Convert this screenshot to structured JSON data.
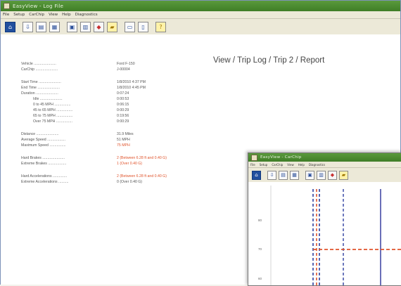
{
  "main": {
    "title": "EasyView - Log File",
    "menu": [
      "File",
      "Setup",
      "CarChip",
      "View",
      "Help",
      "Diagnostics"
    ],
    "toolbar_icons": [
      "home-icon",
      "download-icon",
      "chart-icon",
      "trip-icon",
      "report-icon",
      "log-icon",
      "alarm-icon",
      "folder-icon",
      "print-icon",
      "page-icon",
      "help-icon"
    ],
    "breadcrumb": "View / Trip Log / Trip 2 / Report",
    "report": {
      "vehicle": {
        "label": "Vehicle ......................",
        "value": "Ford F-150"
      },
      "carchip": {
        "label": "CarChip ......................",
        "value": "J-00004"
      },
      "start_time": {
        "label": "Start Time ......................",
        "value": "1/8/2010 4:37 PM"
      },
      "end_time": {
        "label": "End Time ......................",
        "value": "1/8/2010 4:45 PM"
      },
      "duration": {
        "label": "Duration ......................",
        "value": "0:07:24"
      },
      "idle": {
        "label": "Idle ......................",
        "value": "0:00:53"
      },
      "r0_45": {
        "label": "0 to 45 MPH ................",
        "value": "0:06:15"
      },
      "r45_65": {
        "label": "45 to 65 MPH ................",
        "value": "0:00:29"
      },
      "r65_75": {
        "label": "65 to 75 MPH ................",
        "value": "0:19:56"
      },
      "over75": {
        "label": "Over 75 MPH ................",
        "value": "0:00:29"
      },
      "distance": {
        "label": "Distance ......................",
        "value": "31.9 Miles"
      },
      "avg_speed": {
        "label": "Average Speed ..................",
        "value": "51 MPH"
      },
      "max_speed": {
        "label": "Maximum Speed ................",
        "value": "75 MPH"
      },
      "hard_brakes": {
        "label": "Hard Brakes ......................",
        "value": "2 (Between 6.28 ft and 0.40 G)"
      },
      "extreme_brakes": {
        "label": "Extreme Brakes ..................",
        "value": "1 (Over 0.40 G)"
      },
      "hard_accel": {
        "label": "Hard Accelerations ..............",
        "value": "2 (Between 6.28 ft and 0.40 G)"
      },
      "extreme_accel": {
        "label": "Extreme Accelerations ..........",
        "value": "0 (Over 0.40 G)"
      }
    }
  },
  "inset": {
    "title": "EasyView - CarChip",
    "menu": [
      "File",
      "Setup",
      "CarChip",
      "View",
      "Help",
      "Diagnostics"
    ],
    "y_ticks": [
      "80",
      "70",
      "60"
    ]
  },
  "colors": {
    "accent_red": "#e0542c",
    "plot_blue": "#2d3fa0",
    "plot_red": "#e0542c",
    "plot_line": "#6a6fb8"
  }
}
